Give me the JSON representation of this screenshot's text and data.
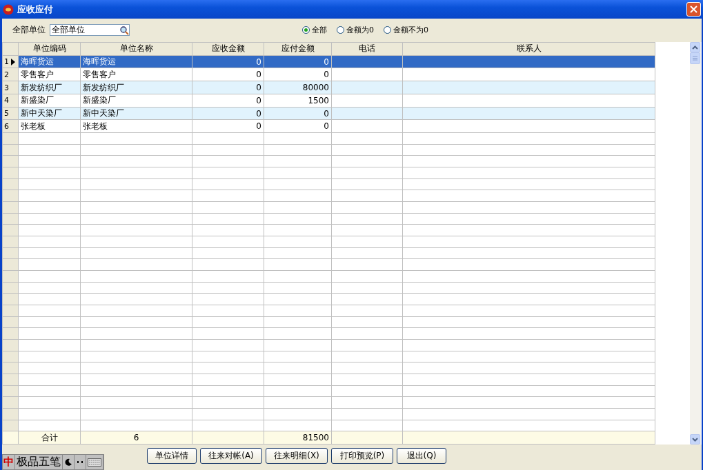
{
  "window": {
    "title": "应收应付"
  },
  "filter": {
    "label": "全部单位",
    "value": "全部单位"
  },
  "radios": [
    {
      "label": "全部",
      "selected": true
    },
    {
      "label": "金额为0",
      "selected": false
    },
    {
      "label": "金额不为0",
      "selected": false
    }
  ],
  "table": {
    "columns": [
      "单位编码",
      "单位名称",
      "应收金额",
      "应付金额",
      "电话",
      "联系人"
    ],
    "rows": [
      {
        "index": "1",
        "selected": true,
        "cells": [
          "海晖货运",
          "海晖货运",
          "0",
          "0"
        ]
      },
      {
        "index": "2",
        "selected": false,
        "cells": [
          "零售客户",
          "零售客户",
          "0",
          "0"
        ]
      },
      {
        "index": "3",
        "selected": false,
        "cells": [
          "新发纺织厂",
          "新发纺织厂",
          "0",
          "80000"
        ]
      },
      {
        "index": "4",
        "selected": false,
        "cells": [
          "新盛染厂",
          "新盛染厂",
          "0",
          "1500"
        ]
      },
      {
        "index": "5",
        "selected": false,
        "cells": [
          "新中天染厂",
          "新中天染厂",
          "0",
          "0"
        ]
      },
      {
        "index": "6",
        "selected": false,
        "cells": [
          "张老板",
          "张老板",
          "0",
          "0"
        ]
      }
    ],
    "totals": {
      "label": "合计",
      "count": "6",
      "payable": "81500"
    }
  },
  "buttons": [
    "单位详情",
    "往来对帐(A)",
    "往来明细(X)",
    "打印预览(P)",
    "退出(Q)"
  ],
  "ime": {
    "mode": "中",
    "name": "极品五笔"
  }
}
